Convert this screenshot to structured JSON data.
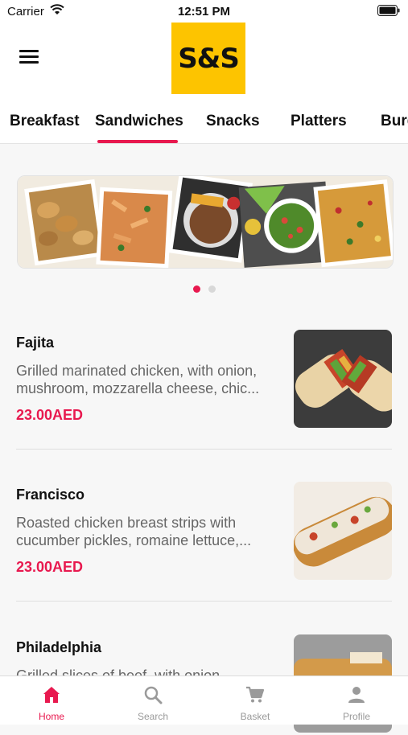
{
  "status_bar": {
    "carrier": "Carrier",
    "time": "12:51 PM"
  },
  "header": {
    "logo_text": "S&S"
  },
  "categories": {
    "items": [
      "Breakfast",
      "Sandwiches",
      "Snacks",
      "Platters",
      "Burg"
    ],
    "active": "Sandwiches"
  },
  "banner": {
    "page_count": 2,
    "active_page": 1
  },
  "menu_items": [
    {
      "name": "Fajita",
      "description": "Grilled marinated chicken, with onion, mushroom, mozzarella cheese, chic...",
      "price": "23.00AED"
    },
    {
      "name": "Francisco",
      "description": "Roasted chicken breast strips with cucumber pickles, romaine lettuce,...",
      "price": "23.00AED"
    },
    {
      "name": "Philadelphia",
      "description": "Grilled slices of beef, with onion",
      "price": ""
    }
  ],
  "tab_bar": {
    "home": "Home",
    "search": "Search",
    "basket": "Basket",
    "profile": "Profile"
  },
  "colors": {
    "accent": "#e8194f",
    "logo_bg": "#fdc400"
  },
  "icons": [
    "menu-icon",
    "wifi-icon",
    "battery-icon",
    "home-icon",
    "search-icon",
    "cart-icon",
    "person-icon"
  ]
}
